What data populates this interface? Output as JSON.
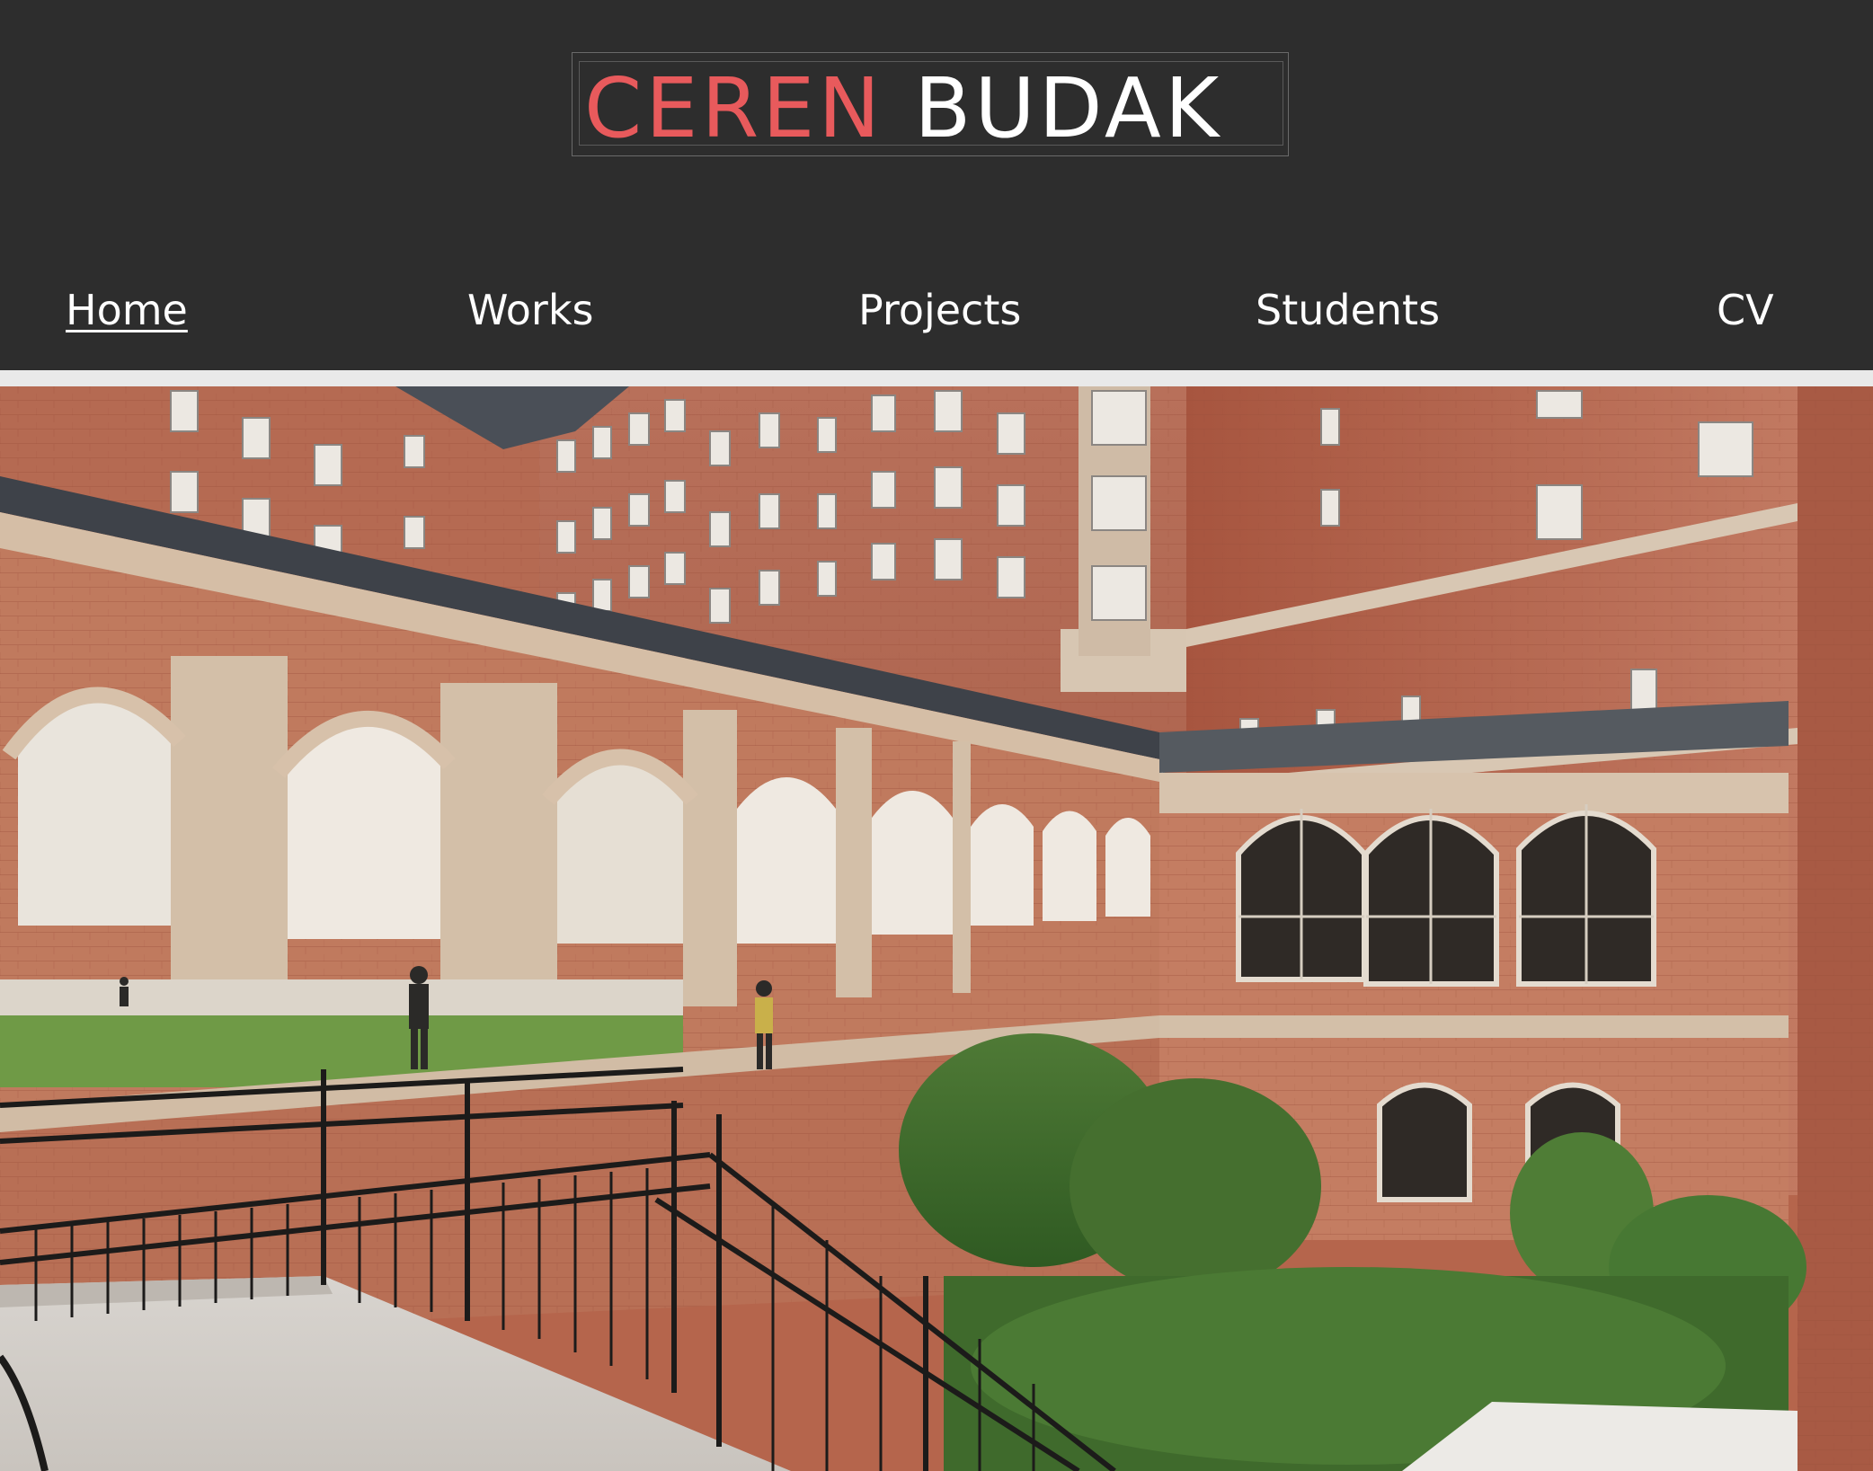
{
  "site": {
    "logo": {
      "first_name": "CEREN",
      "last_name": "BUDAK"
    }
  },
  "nav": {
    "items": [
      {
        "label": "Home",
        "active": true
      },
      {
        "label": "Works",
        "active": false
      },
      {
        "label": "Projects",
        "active": false
      },
      {
        "label": "Students",
        "active": false
      },
      {
        "label": "CV",
        "active": false
      }
    ]
  },
  "hero": {
    "image": "campus-courtyard-photo"
  },
  "colors": {
    "background": "#2d2d2d",
    "accent": "#e85a5c",
    "text": "#ffffff",
    "divider": "#e9e9e9"
  }
}
